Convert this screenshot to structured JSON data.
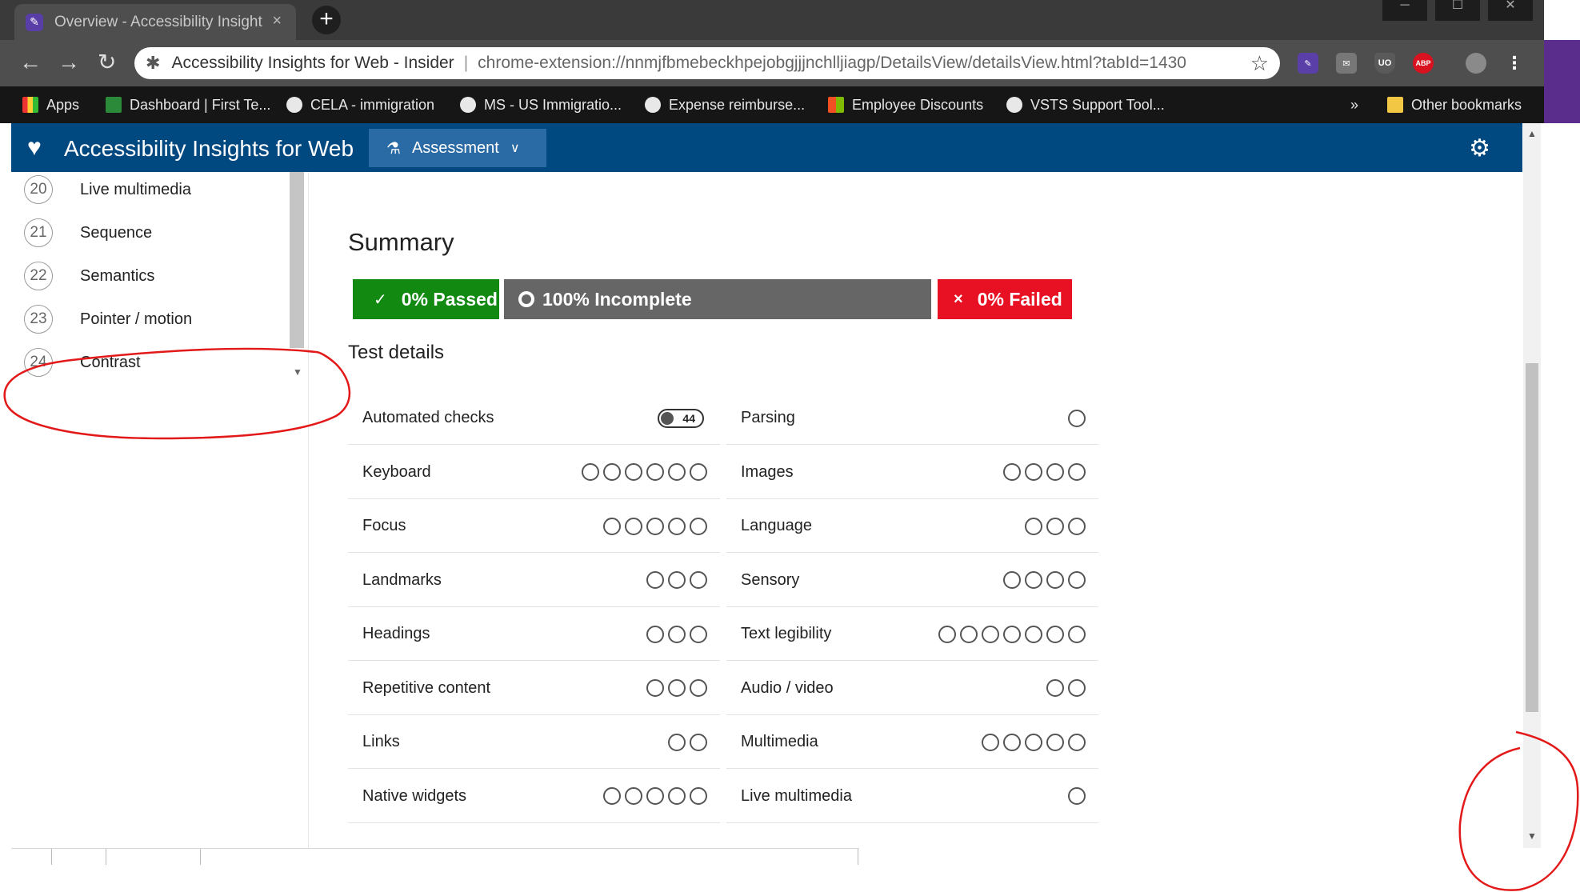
{
  "browser": {
    "tab_title": "Overview - Accessibility Insights",
    "tab_close": "×",
    "new_tab": "+",
    "window_controls": [
      "─",
      "☐",
      "✕"
    ],
    "back": "←",
    "forward": "→",
    "reload": "↻",
    "site_name": "Accessibility Insights for Web - Insider",
    "url": "chrome-extension://nnmjfbmebeckhpejobgjjjnchlljiagp/DetailsView/detailsView.html?tabId=1430",
    "extensions": [
      "UO",
      "ABP"
    ],
    "bookmarks": [
      "Apps",
      "Dashboard | First Te...",
      "CELA - immigration",
      "MS - US Immigratio...",
      "Expense reimburse...",
      "Employee Discounts",
      "VSTS Support Tool..."
    ],
    "bookmarks_overflow": "»",
    "other_bookmarks": "Other bookmarks"
  },
  "app": {
    "title": "Accessibility Insights for Web",
    "assessment_label": "Assessment"
  },
  "leftnav": {
    "items": [
      {
        "num": "20",
        "label": "Live multimedia"
      },
      {
        "num": "21",
        "label": "Sequence"
      },
      {
        "num": "22",
        "label": "Semantics"
      },
      {
        "num": "23",
        "label": "Pointer / motion"
      },
      {
        "num": "24",
        "label": "Contrast"
      }
    ]
  },
  "summary": {
    "title": "Summary",
    "passed": "0% Passed",
    "incomplete": "100% Incomplete",
    "failed": "0% Failed",
    "passed_pct": 0,
    "incomplete_pct": 100,
    "failed_pct": 0,
    "colors": {
      "passed": "#128a12",
      "incomplete": "#666666",
      "failed": "#e81123"
    }
  },
  "test_details": {
    "title": "Test details",
    "automated_count": "44",
    "left": [
      {
        "name": "Automated checks",
        "steps": 0
      },
      {
        "name": "Keyboard",
        "steps": 6
      },
      {
        "name": "Focus",
        "steps": 5
      },
      {
        "name": "Landmarks",
        "steps": 3
      },
      {
        "name": "Headings",
        "steps": 3
      },
      {
        "name": "Repetitive content",
        "steps": 3
      },
      {
        "name": "Links",
        "steps": 2
      },
      {
        "name": "Native widgets",
        "steps": 5
      }
    ],
    "right": [
      {
        "name": "Parsing",
        "steps": 1
      },
      {
        "name": "Images",
        "steps": 4
      },
      {
        "name": "Language",
        "steps": 3
      },
      {
        "name": "Sensory",
        "steps": 4
      },
      {
        "name": "Text legibility",
        "steps": 7
      },
      {
        "name": "Audio / video",
        "steps": 2
      },
      {
        "name": "Multimedia",
        "steps": 5
      },
      {
        "name": "Live multimedia",
        "steps": 1
      }
    ]
  },
  "colors": {
    "header": "#004880",
    "accent": "#2a6aa5"
  }
}
